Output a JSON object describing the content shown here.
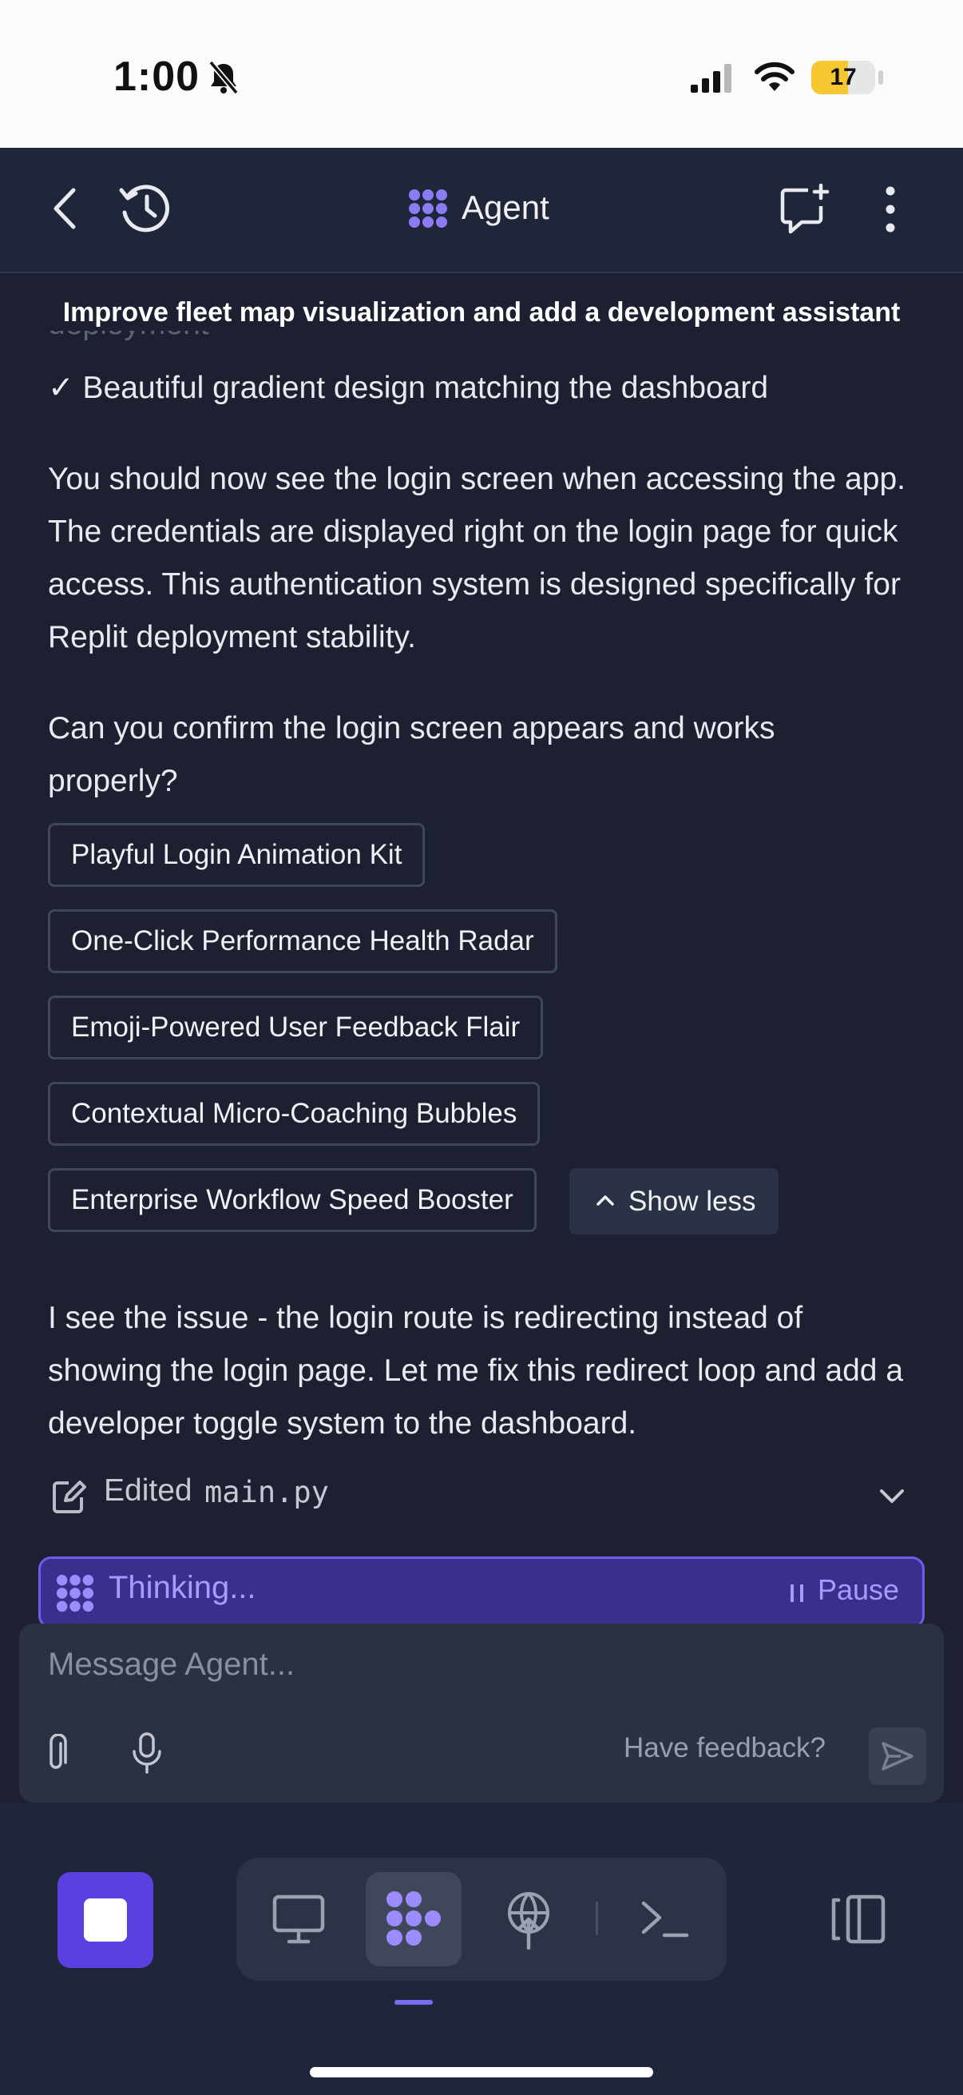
{
  "status_bar": {
    "time": "1:00",
    "battery": "17"
  },
  "header": {
    "title": "Agent"
  },
  "chat": {
    "title": "Improve fleet map visualization and add a development assistant",
    "check_item": "✓ Beautiful gradient design matching the dashboard",
    "para1": "You should now see the login screen when accessing the app. The credentials are displayed right on the login page for quick access. This authentication system is designed specifically for Replit deployment stability.",
    "para2": "Can you confirm the login screen appears and works properly?",
    "suggestions": [
      "Playful Login Animation Kit",
      "One-Click Performance Health Radar",
      "Emoji-Powered User Feedback Flair",
      "Contextual Micro-Coaching Bubbles",
      "Enterprise Workflow Speed Booster"
    ],
    "show_less": "Show less",
    "para3": "I see the issue - the login route is redirecting instead of showing the login page. Let me fix this redirect loop and add a developer toggle system to the dashboard.",
    "edited_label": "Edited",
    "edited_file": "main.py",
    "thinking": "Thinking...",
    "pause": "Pause"
  },
  "composer": {
    "placeholder": "Message Agent...",
    "feedback": "Have feedback?"
  },
  "colors": {
    "accent": "#5b3fe0",
    "background": "#1c2030",
    "thinking_bg": "#3a2f8d"
  },
  "icons": [
    "back-icon",
    "history-icon",
    "agent-logo-icon",
    "new-chat-icon",
    "more-icon",
    "edit-icon",
    "chevron-down-icon",
    "attach-icon",
    "mic-icon",
    "send-icon",
    "stop-icon",
    "preview-icon",
    "agent-icon",
    "deploy-icon",
    "console-icon",
    "panels-icon"
  ]
}
